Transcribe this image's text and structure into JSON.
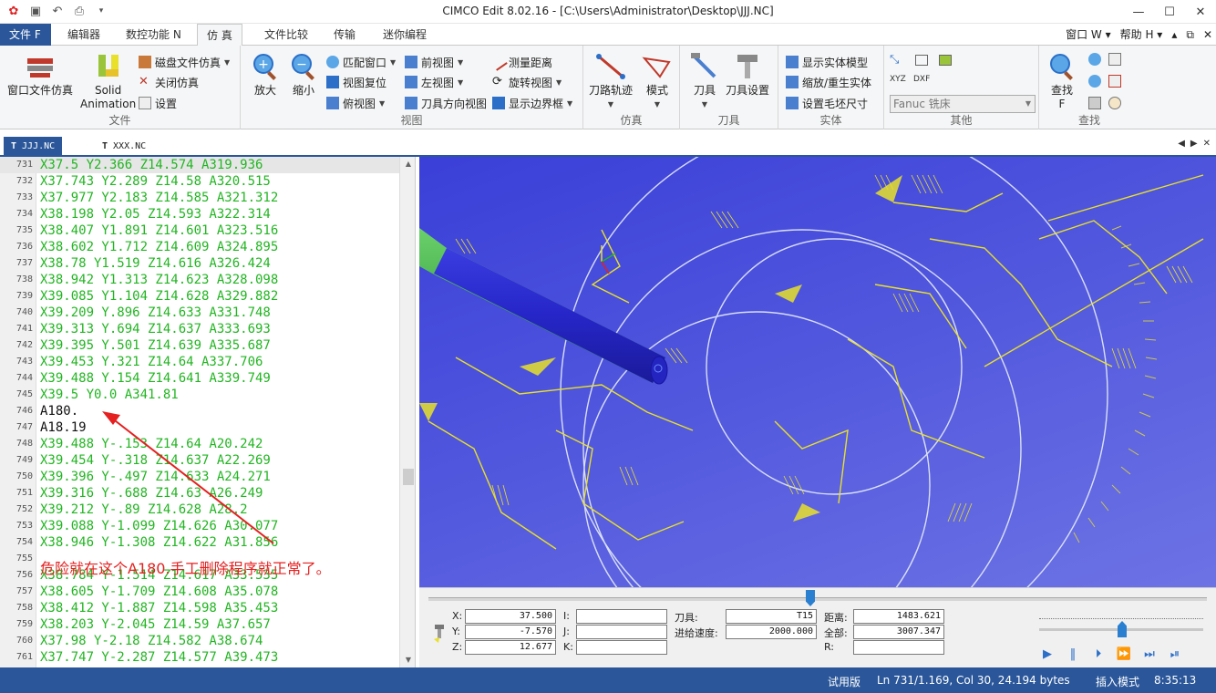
{
  "window": {
    "title": "CIMCO Edit 8.02.16 - [C:\\Users\\Administrator\\Desktop\\JJJ.NC]",
    "controls": [
      "—",
      "☐",
      "✕"
    ]
  },
  "ribbon_tabs": {
    "file": "文件 F",
    "items": [
      "编辑器",
      "数控功能 N",
      "仿 真",
      "文件比较",
      "传输",
      "迷你编程"
    ],
    "right": [
      "窗口 W ▾",
      "帮助 H ▾",
      "▴",
      "⧉",
      "✕"
    ]
  },
  "ribbon": {
    "file_group": {
      "label": "文件",
      "btn_window_sim": "窗口文件仿真",
      "btn_solid_1": "Solid",
      "btn_solid_2": "Animation",
      "btn_disk_sim": "磁盘文件仿真",
      "btn_close_sim": "关闭仿真",
      "btn_settings": "设置"
    },
    "view_group": {
      "label": "视图",
      "btn_zoom_in": "放大",
      "btn_zoom_out": "缩小",
      "btn_fit": "匹配窗口",
      "btn_reset": "视图复位",
      "btn_top": "俯视图",
      "btn_front": "前视图",
      "btn_left": "左视图",
      "btn_tooldir": "刀具方向视图",
      "btn_measure": "测量距离",
      "btn_rotate": "旋转视图",
      "btn_border": "显示边界框"
    },
    "sim_group": {
      "label": "仿真",
      "btn_toolpath": "刀路轨迹",
      "btn_mode": "模式"
    },
    "tool_group": {
      "label": "刀具",
      "btn_tool": "刀具",
      "btn_tool_setup": "刀具设置"
    },
    "solid_group": {
      "label": "实体",
      "btn_show_solid": "显示实体模型",
      "btn_zoom_regen": "缩放/重生实体",
      "btn_stock": "设置毛坯尺寸"
    },
    "other_group": {
      "label": "其他",
      "machine_select": "Fanuc 铣床"
    },
    "find_group": {
      "label": "查找",
      "btn_find_1": "查找",
      "btn_find_2": "F"
    }
  },
  "doc_tabs": [
    "JJJ.NC",
    "XXX.NC"
  ],
  "editor": {
    "lines": [
      {
        "n": "731",
        "t": "X37.5 Y2.366 Z14.574 A319.936"
      },
      {
        "n": "732",
        "t": "X37.743 Y2.289 Z14.58 A320.515"
      },
      {
        "n": "733",
        "t": "X37.977 Y2.183 Z14.585 A321.312"
      },
      {
        "n": "734",
        "t": "X38.198 Y2.05 Z14.593 A322.314"
      },
      {
        "n": "735",
        "t": "X38.407 Y1.891 Z14.601 A323.516"
      },
      {
        "n": "736",
        "t": "X38.602 Y1.712 Z14.609 A324.895"
      },
      {
        "n": "737",
        "t": "X38.78 Y1.519 Z14.616 A326.424"
      },
      {
        "n": "738",
        "t": "X38.942 Y1.313 Z14.623 A328.098"
      },
      {
        "n": "739",
        "t": "X39.085 Y1.104 Z14.628 A329.882"
      },
      {
        "n": "740",
        "t": "X39.209 Y.896 Z14.633 A331.748"
      },
      {
        "n": "741",
        "t": "X39.313 Y.694 Z14.637 A333.693"
      },
      {
        "n": "742",
        "t": "X39.395 Y.501 Z14.639 A335.687"
      },
      {
        "n": "743",
        "t": "X39.453 Y.321 Z14.64 A337.706"
      },
      {
        "n": "744",
        "t": "X39.488 Y.154 Z14.641 A339.749"
      },
      {
        "n": "745",
        "t": "X39.5 Y0.0 A341.81"
      },
      {
        "n": "746",
        "t": "A180."
      },
      {
        "n": "747",
        "t": "A18.19"
      },
      {
        "n": "748",
        "t": "X39.488 Y-.153 Z14.64 A20.242"
      },
      {
        "n": "749",
        "t": "X39.454 Y-.318 Z14.637 A22.269"
      },
      {
        "n": "750",
        "t": "X39.396 Y-.497 Z14.633 A24.271"
      },
      {
        "n": "751",
        "t": "X39.316 Y-.688 Z14.63 A26.249"
      },
      {
        "n": "752",
        "t": "X39.212 Y-.89 Z14.628 A28.2"
      },
      {
        "n": "753",
        "t": "X39.088 Y-1.099 Z14.626 A30.077"
      },
      {
        "n": "754",
        "t": "X38.946 Y-1.308 Z14.622 A31.856"
      },
      {
        "n": "755",
        "t": ""
      },
      {
        "n": "756",
        "t": "X38.784 Y-1.514 Z14.617 A33.535"
      },
      {
        "n": "757",
        "t": "X38.605 Y-1.709 Z14.608 A35.078"
      },
      {
        "n": "758",
        "t": "X38.412 Y-1.887 Z14.598 A35.453"
      },
      {
        "n": "759",
        "t": "X38.203 Y-2.045 Z14.59 A37.657"
      },
      {
        "n": "760",
        "t": "X37.98 Y-2.18 Z14.582 A38.674"
      },
      {
        "n": "761",
        "t": "X37.747 Y-2.287 Z14.577 A39.473"
      }
    ],
    "annotation": "危险就在这个A180.手工删除程序就正常了。"
  },
  "panel": {
    "x_label": "X:",
    "x_value": "37.500",
    "y_label": "Y:",
    "y_value": "-7.570",
    "z_label": "Z:",
    "z_value": "12.677",
    "i_label": "I:",
    "j_label": "J:",
    "k_label": "K:",
    "tool_label": "刀具:",
    "tool_value": "T15",
    "feed_label": "进给速度:",
    "feed_value": "2000.000",
    "dist_label": "距离:",
    "dist_value": "1483.621",
    "total_label": "全部:",
    "total_value": "3007.347",
    "r_label": "R:"
  },
  "status": {
    "mode": "试用版",
    "position": "Ln 731/1.169, Col 30, 24.194 bytes",
    "insert": "插入模式",
    "time": "8:35:13"
  },
  "colors": {
    "accent": "#2b579a",
    "code_green": "#22b522",
    "viewport_blue": "#4a50dc",
    "toolpath_yellow": "#e8e02a",
    "annotation_red": "#e52020"
  }
}
